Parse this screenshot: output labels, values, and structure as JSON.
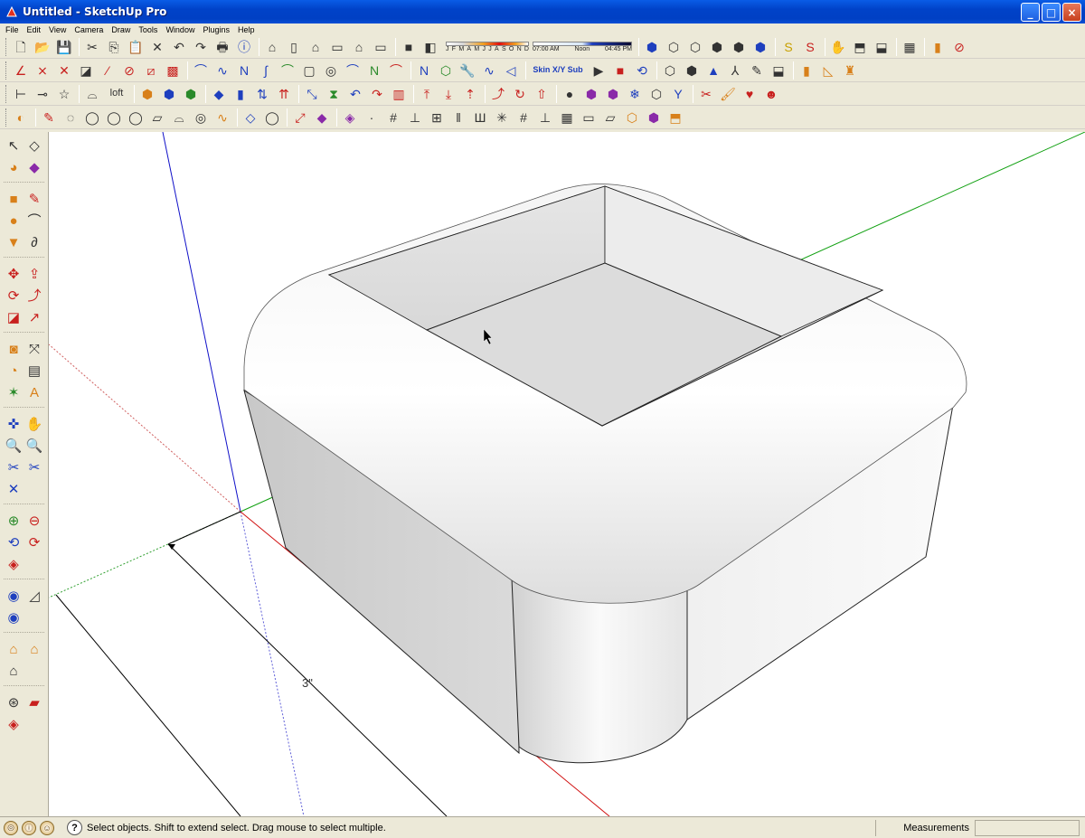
{
  "window": {
    "title": "Untitled - SketchUp Pro",
    "minimize": "_",
    "maximize": "□",
    "close": "×"
  },
  "menu": [
    "File",
    "Edit",
    "View",
    "Camera",
    "Draw",
    "Tools",
    "Window",
    "Plugins",
    "Help"
  ],
  "shadows": {
    "months": [
      "J",
      "F",
      "M",
      "A",
      "M",
      "J",
      "J",
      "A",
      "S",
      "O",
      "N",
      "D"
    ],
    "time_start": "07:00 AM",
    "time_mid": "Noon",
    "time_end": "04:45 PM"
  },
  "toolbar": {
    "loft_label": "loft",
    "skin_label": "Skin X/Y Sub"
  },
  "model": {
    "dimension_label": "3\""
  },
  "status": {
    "hint": "Select objects. Shift to extend select. Drag mouse to select multiple.",
    "measurements_label": "Measurements",
    "measurements_value": ""
  },
  "colors": {
    "axis_red": "#d01010",
    "axis_green": "#10a010",
    "axis_blue": "#1010c8"
  }
}
